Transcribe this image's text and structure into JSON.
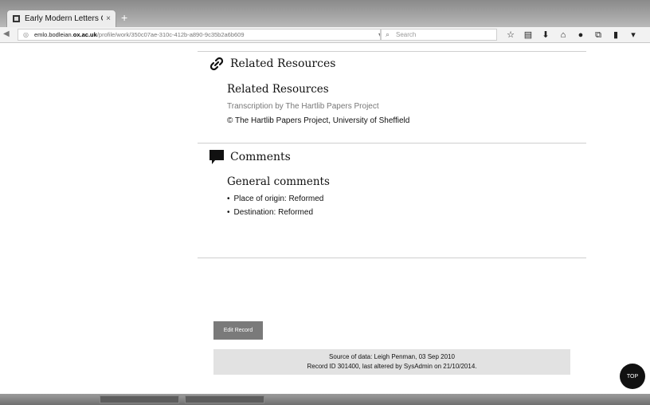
{
  "browser": {
    "tab_title": "Early Modern Letters Onlin...",
    "tab_close": "×",
    "new_tab": "+",
    "url_host": "emlo.bodleian.",
    "url_domain": "ox.ac.uk",
    "url_path": "/profile/work/350c07ae-310c-412b-a890-9c35b2a6b609",
    "search_placeholder": "Search"
  },
  "related": {
    "heading": "Related Resources",
    "subheading": "Related Resources",
    "transcription": "Transcription by The Hartlib Papers Project",
    "copyright": "© The Hartlib Papers Project, University of Sheffield"
  },
  "comments": {
    "heading": "Comments",
    "subheading": "General comments",
    "items": [
      "Place of origin: Reformed",
      "Destination: Reformed"
    ]
  },
  "edit_button_label": "Edit Record",
  "footer": {
    "source": "Source of data: Leigh Penman, 03 Sep 2010",
    "record": "Record ID 301400, last altered by SysAdmin on 21/10/2014."
  },
  "top_button_label": "TOP",
  "icons": [
    "page-favicon",
    "globe-icon",
    "reload-icon",
    "search-icon",
    "star-icon",
    "clipboard-icon",
    "download-icon",
    "home-icon",
    "chat-icon",
    "puzzle-icon",
    "trash-icon",
    "chevron-down-icon",
    "link-icon",
    "comment-icon"
  ]
}
